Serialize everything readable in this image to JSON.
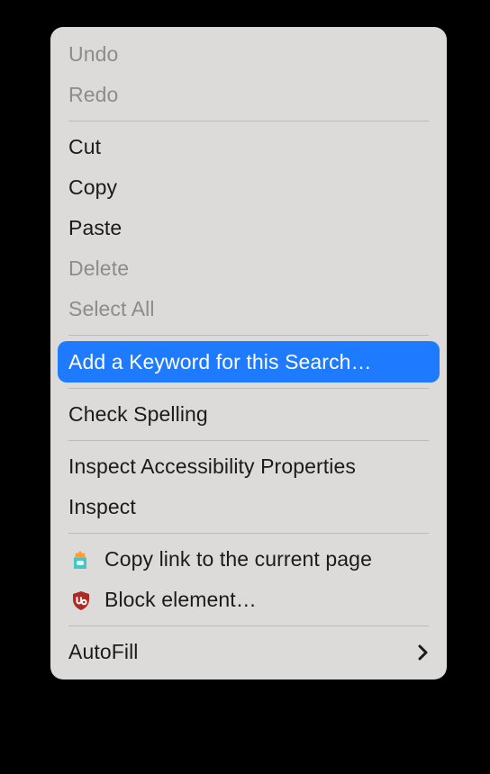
{
  "menu": {
    "undo": "Undo",
    "redo": "Redo",
    "cut": "Cut",
    "copy": "Copy",
    "paste": "Paste",
    "delete": "Delete",
    "select_all": "Select All",
    "add_keyword": "Add a Keyword for this Search…",
    "check_spelling": "Check Spelling",
    "inspect_a11y": "Inspect Accessibility Properties",
    "inspect": "Inspect",
    "copy_link": "Copy link to the current page",
    "block_element": "Block element…",
    "autofill": "AutoFill"
  }
}
